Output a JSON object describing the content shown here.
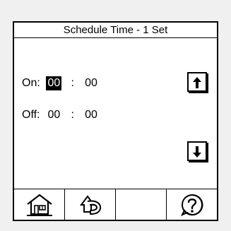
{
  "screen": {
    "title": "Schedule Time - 1 Set"
  },
  "on": {
    "label": "On:",
    "hours": "00",
    "separator": ":",
    "minutes": "00"
  },
  "off": {
    "label": "Off:",
    "hours": "00",
    "separator": ":",
    "minutes": "00"
  },
  "buttons": {
    "up": "arrow-up-icon",
    "down": "arrow-down-icon"
  },
  "toolbar": {
    "items": [
      "home-icon",
      "back-icon",
      "empty",
      "help-icon"
    ]
  }
}
